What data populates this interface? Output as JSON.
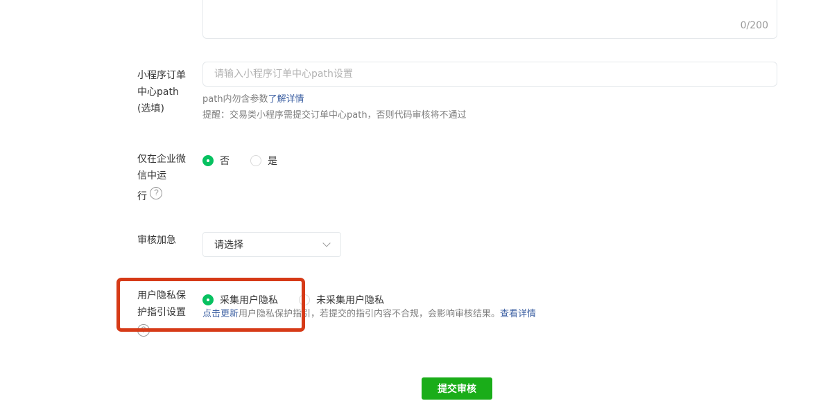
{
  "description_field": {
    "counter": "0/200"
  },
  "order_path": {
    "label_lines": [
      "小程序订单",
      "中心path",
      "(选填)"
    ],
    "placeholder": "请输入小程序订单中心path设置",
    "hint_text": "path内勿含参数",
    "hint_link": "了解详情",
    "reminder": "提醒：交易类小程序需提交订单中心path，否则代码审核将不通过"
  },
  "enterprise_wechat": {
    "label_lines": [
      "仅在企业微",
      "信中运",
      "行"
    ],
    "options": [
      {
        "label": "否",
        "selected": true
      },
      {
        "label": "是",
        "selected": false
      }
    ]
  },
  "review_expedite": {
    "label": "审核加急",
    "selected": "请选择"
  },
  "privacy": {
    "label_lines": [
      "用户隐私保",
      "护指引设置"
    ],
    "options": [
      {
        "label": "采集用户隐私",
        "selected": true
      },
      {
        "label": "未采集用户隐私",
        "selected": false
      }
    ],
    "update_link": "点击更新",
    "hint_text": "用户隐私保护指引，若提交的指引内容不合规，会影响审核结果。",
    "details_link": "查看详情"
  },
  "submit": {
    "label": "提交审核"
  },
  "colors": {
    "accent": "#07c160",
    "button": "#1aad19",
    "link": "#3e61a3",
    "highlight": "#d63a17"
  },
  "icons": {
    "help": "question-circle-icon",
    "dropdown": "chevron-down-icon"
  }
}
